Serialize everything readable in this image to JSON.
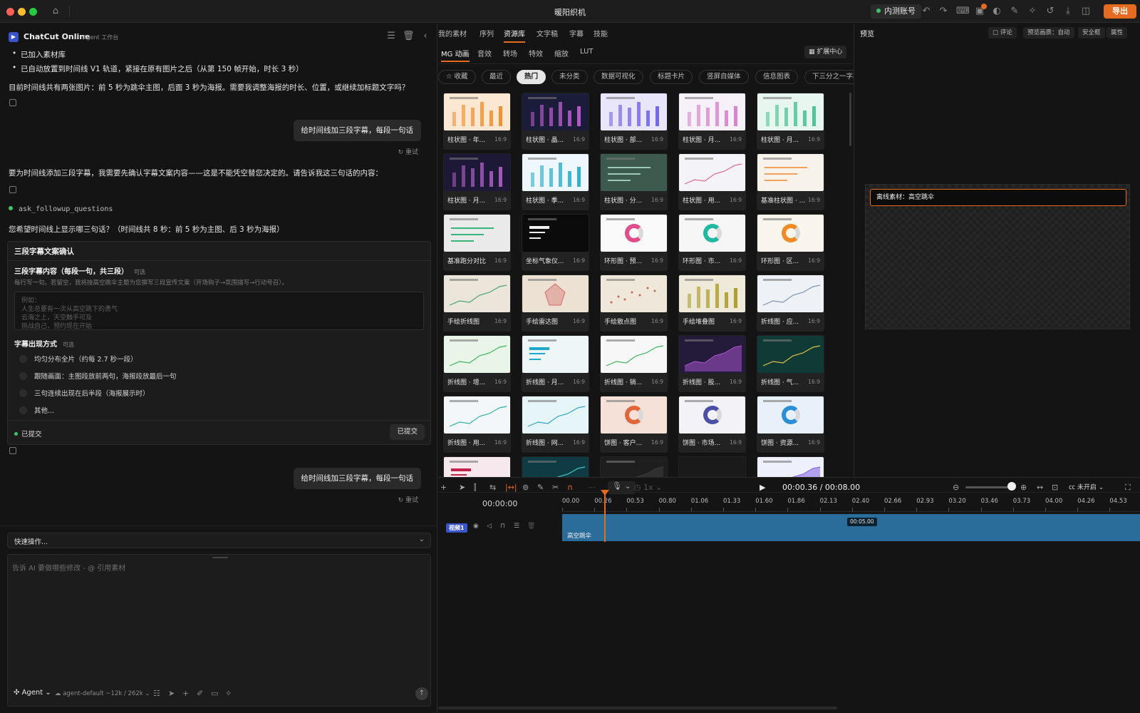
{
  "window": {
    "title": "暖阳织机",
    "inner_account": "内测账号",
    "export": "导出"
  },
  "agent": {
    "name": "ChatCut Online",
    "subtitle": "Agent 工作台",
    "messages": {
      "b1": "已加入素材库",
      "b2": "已自动放置到时间线 V1 轨道，紧接在原有图片之后（从第 150 帧开始，时长 3 秒）",
      "m1": "目前时间线共有两张图片：前 5 秒为跳伞主图，后面 3 秒为海报。需要我调整海报的时长、位置，或继续加标题文字吗？",
      "user1": "给时间线加三段字幕，每段一句话",
      "retry": "重试",
      "m2": "要为时间线添加三段字幕，我需要先确认字幕文案内容——这是不能凭空替您决定的。请告诉我这三句话的内容：",
      "tool": "ask_followup_questions",
      "m3": "您希望时间线上显示哪三句话？（时间线共 8 秒：前 5 秒为主图、后 3 秒为海报）",
      "user2": "给时间线加三段字幕，每段一句话"
    },
    "question_card": {
      "title": "三段字幕文案确认",
      "q1_label": "三段字幕内容（每段一句，共三段）",
      "optional": "可选",
      "q1_hint": "每行写一句。若留空，我将按高空跳伞主题为您撰写三段宣传文案（开场钩子→氛围描写→行动号召）。",
      "placeholder_lines": [
        "例如：",
        "人生总要有一次从高空跳下的勇气",
        "云海之上，天空触手可及",
        "挑战自己，预约现在开始"
      ],
      "q2_label": "字幕出现方式",
      "options": [
        "均匀分布全片（约每 2.7 秒一段）",
        "跟随画面：主图段放前两句，海报段放最后一句",
        "三句连续出现在后半段（海报展示时）",
        "其他..."
      ],
      "status": "已提交",
      "submitted_btn": "已提交"
    },
    "quick_actions": "快速操作...",
    "input_placeholder": "告诉 AI 要做哪些修改 - @ 引用素材",
    "agent_mode": "Agent",
    "model": "agent-default ~12k / 262k"
  },
  "library": {
    "tabs": [
      "我的素材",
      "序列",
      "资源库",
      "文字稿",
      "字幕",
      "技能"
    ],
    "active_tab": "资源库",
    "subtabs": [
      "MG 动画",
      "音效",
      "转场",
      "特效",
      "缩放",
      "LUT"
    ],
    "active_subtab": "MG 动画",
    "extension_center": "扩展中心",
    "chips": [
      "☆ 收藏",
      "最近",
      "热门",
      "未分类",
      "数据可视化",
      "标题卡片",
      "竖屏自媒体",
      "信息图表",
      "下三分之一字幕"
    ],
    "active_chip": "热门",
    "items": [
      {
        "label": "柱状图 · 年...",
        "ratio": "16:9",
        "bg": "#fbe7d2",
        "kind": "bars",
        "accent": "#f08a24"
      },
      {
        "label": "柱状图 · 晶...",
        "ratio": "16:9",
        "bg": "#1b1b3a",
        "kind": "bars",
        "accent": "#c25fd6"
      },
      {
        "label": "柱状图 · 部...",
        "ratio": "16:9",
        "bg": "#e9e6fb",
        "kind": "bars",
        "accent": "#6a5bea"
      },
      {
        "label": "柱状图 · 月...",
        "ratio": "16:9",
        "bg": "#f6f1f8",
        "kind": "bars",
        "accent": "#d57ac6"
      },
      {
        "label": "柱状图 · 月...",
        "ratio": "16:9",
        "bg": "#e8f6f0",
        "kind": "bars",
        "accent": "#3fbf8f"
      },
      {
        "label": "柱状图 · 月...",
        "ratio": "16:9",
        "bg": "#1d1836",
        "kind": "bars",
        "accent": "#b061c9"
      },
      {
        "label": "柱状图 · 季...",
        "ratio": "16:9",
        "bg": "#eef7fb",
        "kind": "bars",
        "accent": "#1fa9c9"
      },
      {
        "label": "柱状图 · 分...",
        "ratio": "16:9",
        "bg": "#3c5a4d",
        "kind": "hlines",
        "accent": "#9bc9b4"
      },
      {
        "label": "柱状图 · 用...",
        "ratio": "16:9",
        "bg": "#f4f4f8",
        "kind": "line",
        "accent": "#e06a8a"
      },
      {
        "label": "基准柱状图 · ...",
        "ratio": "16:9",
        "bg": "#f7f2ea",
        "kind": "hlines",
        "accent": "#f2a15a"
      },
      {
        "label": "基准跑分对比",
        "ratio": "16:9",
        "bg": "#eaeaea",
        "kind": "hlines",
        "accent": "#37b67a"
      },
      {
        "label": "坐标气象仪...",
        "ratio": "16:9",
        "bg": "#0b0b0b",
        "kind": "text",
        "accent": "#f0f0f0"
      },
      {
        "label": "环形图 · 预...",
        "ratio": "16:9",
        "bg": "#fafafa",
        "kind": "donut",
        "accent": "#e24b8c"
      },
      {
        "label": "环形图 · 市...",
        "ratio": "16:9",
        "bg": "#f6f6f6",
        "kind": "donut",
        "accent": "#1fb8a0"
      },
      {
        "label": "环形图 · 区...",
        "ratio": "16:9",
        "bg": "#f9f4ec",
        "kind": "donut",
        "accent": "#f08a24"
      },
      {
        "label": "手绘折线图",
        "ratio": "16:9",
        "bg": "#ece6da",
        "kind": "line",
        "accent": "#4aa37a"
      },
      {
        "label": "手绘雷达图",
        "ratio": "16:9",
        "bg": "#ece1d3",
        "kind": "radar",
        "accent": "#d56a6a"
      },
      {
        "label": "手绘散点图",
        "ratio": "16:9",
        "bg": "#efe8da",
        "kind": "scatter",
        "accent": "#c06a4a"
      },
      {
        "label": "手绘堆叠图",
        "ratio": "16:9",
        "bg": "#efe9d9",
        "kind": "bars",
        "accent": "#a8961f"
      },
      {
        "label": "折线图 · 应...",
        "ratio": "16:9",
        "bg": "#eef1f5",
        "kind": "line",
        "accent": "#7f93b0"
      },
      {
        "label": "折线图 · 增...",
        "ratio": "16:9",
        "bg": "#eaf5ea",
        "kind": "line",
        "accent": "#3db65d"
      },
      {
        "label": "折线图 · 月...",
        "ratio": "16:9",
        "bg": "#eef6f8",
        "kind": "text",
        "accent": "#1fa9c9"
      },
      {
        "label": "折线图 · 销...",
        "ratio": "16:9",
        "bg": "#f7f7f7",
        "kind": "line",
        "accent": "#3db65d"
      },
      {
        "label": "折线图 · 股...",
        "ratio": "16:9",
        "bg": "#241a3a",
        "kind": "area",
        "accent": "#9b4fbf"
      },
      {
        "label": "折线图 · 气...",
        "ratio": "16:9",
        "bg": "#0f3a35",
        "kind": "line",
        "accent": "#e2c24a"
      },
      {
        "label": "折线图 · 用...",
        "ratio": "16:9",
        "bg": "#f4f7fa",
        "kind": "line",
        "accent": "#2fb5a5"
      },
      {
        "label": "折线图 · 网...",
        "ratio": "16:9",
        "bg": "#e6f5f8",
        "kind": "line",
        "accent": "#2fa8c8"
      },
      {
        "label": "饼图 · 客户...",
        "ratio": "16:9",
        "bg": "#f6e1d8",
        "kind": "donut",
        "accent": "#e2653a"
      },
      {
        "label": "饼图 · 市场...",
        "ratio": "16:9",
        "bg": "#f3f3f7",
        "kind": "donut",
        "accent": "#4a4fa8"
      },
      {
        "label": "饼图 · 资源...",
        "ratio": "16:9",
        "bg": "#e8f1f9",
        "kind": "donut",
        "accent": "#2a8fd6"
      },
      {
        "label": "",
        "ratio": "",
        "bg": "#f7e8ee",
        "kind": "text",
        "accent": "#c2224a"
      },
      {
        "label": "",
        "ratio": "",
        "bg": "#0e3b44",
        "kind": "line",
        "accent": "#3fc9c9"
      },
      {
        "label": "",
        "ratio": "",
        "bg": "#1e1e1e",
        "kind": "area",
        "accent": "#3a3a3a"
      },
      {
        "label": "",
        "ratio": "",
        "bg": "#1a1a1a",
        "kind": "none",
        "accent": "#1a1a1a"
      },
      {
        "label": "",
        "ratio": "",
        "bg": "#eef0fb",
        "kind": "area",
        "accent": "#8a6aea"
      }
    ]
  },
  "preview": {
    "title": "预览",
    "buttons": [
      "评论",
      "预览画质：自动",
      "安全框",
      "属性"
    ],
    "offline_label": "离线素材：高空跳伞"
  },
  "timeline": {
    "timecode": "00:00.36 / 00:08.00",
    "speed": "1x",
    "cc": "未开启",
    "current": "00:00:00",
    "ticks": [
      "00.00",
      "00.26",
      "00.53",
      "00.80",
      "01.06",
      "01.33",
      "01.60",
      "01.86",
      "02.13",
      "02.40",
      "02.66",
      "02.93",
      "03.20",
      "03.46",
      "03.73",
      "04.00",
      "04.26",
      "04.53"
    ],
    "track_label": "视频1",
    "clip_label": "高空跳伞",
    "clip_end_marker": "00:05.00",
    "playhead_seconds": 0.36,
    "duration_seconds": 8.0
  },
  "colors": {
    "accent": "#e66a1f",
    "success": "#3ec56a",
    "track": "#3a54c9",
    "clip": "#2a6d9a"
  }
}
